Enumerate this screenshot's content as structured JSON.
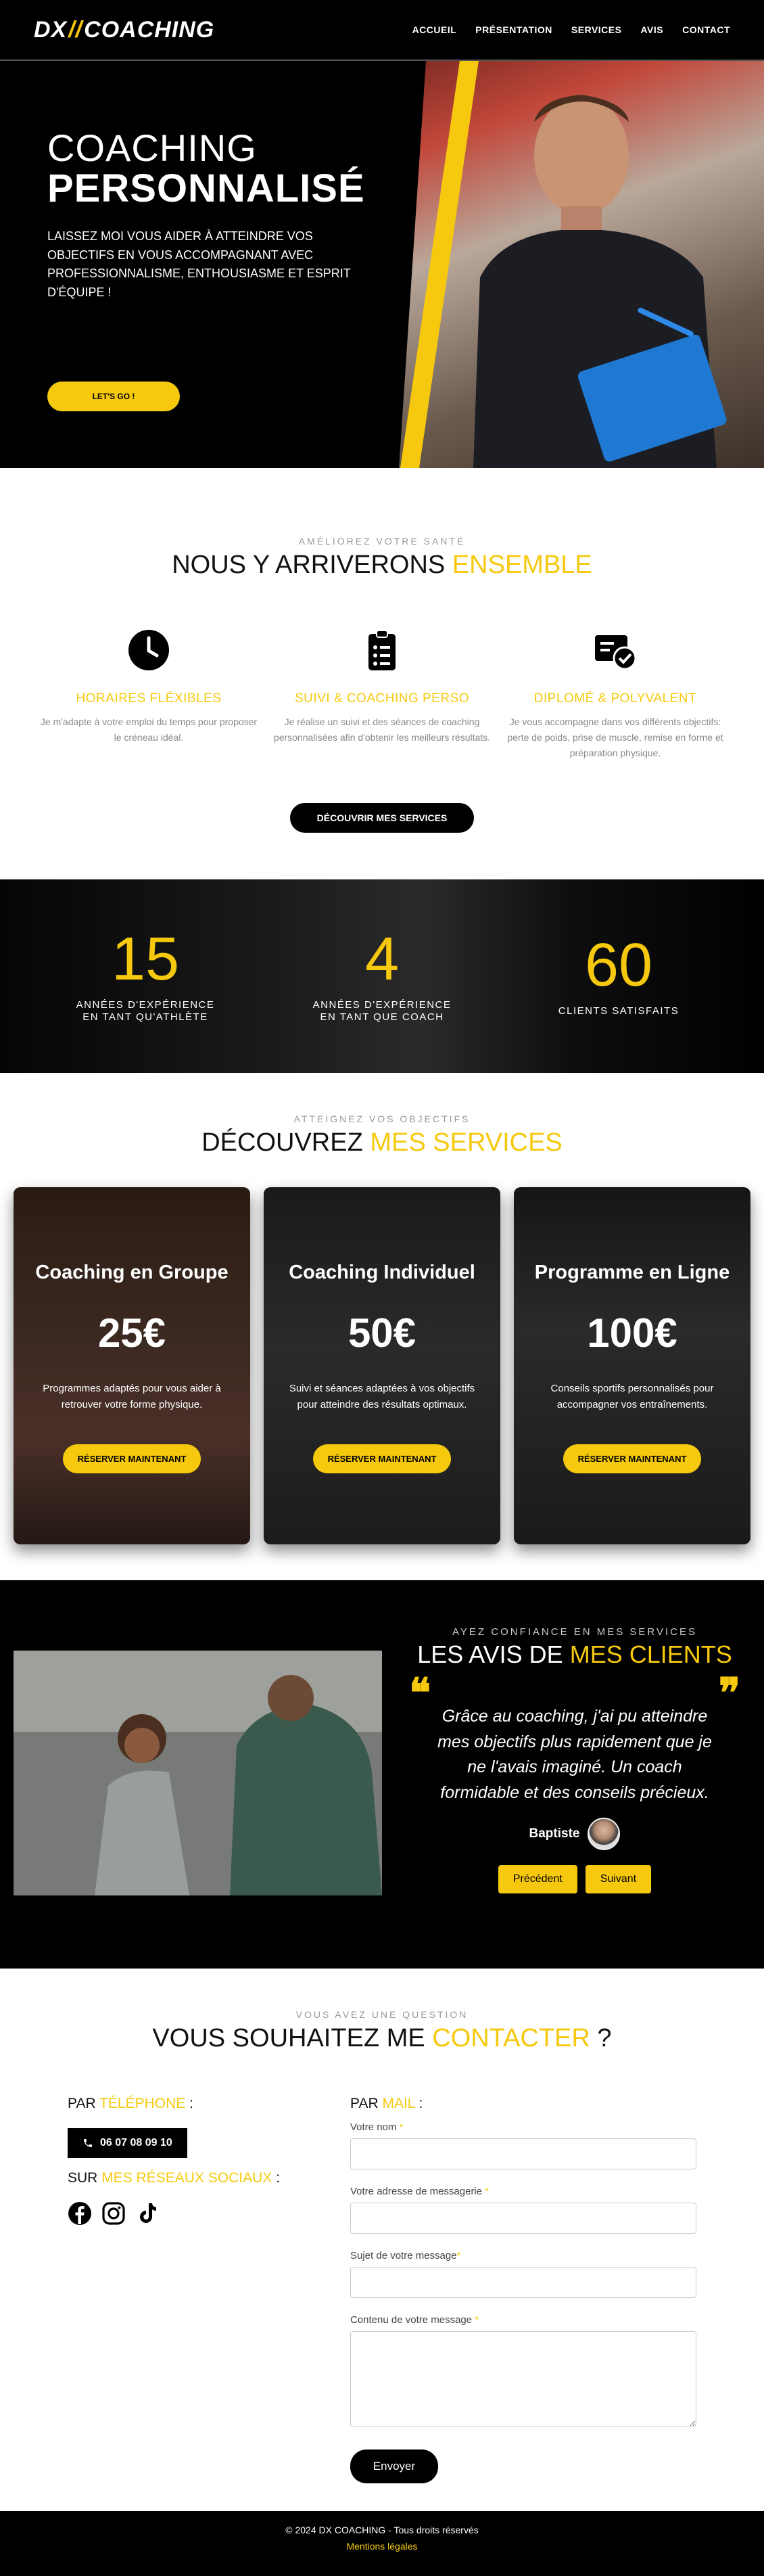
{
  "nav": {
    "logo_left": "DX",
    "logo_mark": "//",
    "logo_right": "COACHING",
    "items": [
      "ACCUEIL",
      "PRÉSENTATION",
      "SERVICES",
      "AVIS",
      "CONTACT"
    ]
  },
  "hero": {
    "title_light": "COACHING",
    "title_bold": "PERSONNALISÉ",
    "text": "LAISSEZ MOI VOUS AIDER À ATTEINDRE VOS OBJECTIFS EN VOUS ACCOMPAGNANT AVEC PROFESSIONNALISME, ENTHOUSIASME ET ESPRIT D'ÉQUIPE !",
    "cta": "LET'S GO !"
  },
  "features": {
    "kicker": "AMÉLIOREZ VOTRE SANTÉ",
    "title_main": "NOUS Y ARRIVERONS ",
    "title_accent": "ENSEMBLE",
    "items": [
      {
        "icon": "clock-icon",
        "title": "HORAIRES FLÉXIBLES",
        "text": "Je m'adapte à votre emploi du temps pour proposer le créneau idéal."
      },
      {
        "icon": "clipboard-list-icon",
        "title": "SUIVI & COACHING PERSO",
        "text": "Je réalise un suivi et des séances de coaching personnalisées afin d'obtenir les meilleurs résultats."
      },
      {
        "icon": "certificate-check-icon",
        "title": "DIPLOMÉ & POLYVALENT",
        "text": "Je vous accompagne dans vos différents objectifs: perte de poids, prise de muscle, remise en forme et préparation physique."
      }
    ],
    "cta": "DÉCOUVRIR MES SERVICES"
  },
  "stats": [
    {
      "num": "15",
      "label_1": "ANNÉES D'EXPÉRIENCE",
      "label_2": "EN TANT QU'ATHLÈTE"
    },
    {
      "num": "4",
      "label_1": "ANNÉES D'EXPÉRIENCE",
      "label_2": "EN TANT QUE COACH"
    },
    {
      "num": "60",
      "label_1": "CLIENTS SATISFAITS",
      "label_2": ""
    }
  ],
  "services": {
    "kicker": "ATTEIGNEZ VOS OBJECTIFS",
    "title_main": "DÉCOUVREZ ",
    "title_accent": "MES SERVICES",
    "cards": [
      {
        "title": "Coaching en Groupe",
        "price": "25€",
        "text": "Programmes adaptés pour vous aider à retrouver votre forme physique.",
        "cta": "RÉSERVER MAINTENANT"
      },
      {
        "title": "Coaching Individuel",
        "price": "50€",
        "text": "Suivi et séances adaptées à vos objectifs pour atteindre des résultats optimaux.",
        "cta": "RÉSERVER MAINTENANT"
      },
      {
        "title": "Programme en Ligne",
        "price": "100€",
        "text": "Conseils sportifs personnalisés pour accompagner vos entraînements.",
        "cta": "RÉSERVER MAINTENANT"
      }
    ]
  },
  "reviews": {
    "kicker": "AYEZ CONFIANCE EN MES SERVICES",
    "title_main": "LES AVIS DE ",
    "title_accent": "MES CLIENTS",
    "quote_open": "❝",
    "quote_close": "❞",
    "text": "Grâce au coaching, j'ai pu atteindre mes objectifs plus rapidement que je ne l'avais imaginé. Un coach formidable et des conseils précieux.",
    "author": "Baptiste",
    "prev": "Précédent",
    "next": "Suivant"
  },
  "contact": {
    "kicker": "VOUS AVEZ UNE QUESTION",
    "title_main": "VOUS SOUHAITEZ ME ",
    "title_accent": "CONTACTER",
    "title_end": " ?",
    "phone_h_main": "PAR ",
    "phone_h_accent": "TÉLÉPHONE",
    "phone_h_end": " :",
    "phone": "06 07 08 09 10",
    "social_h_main": "SUR ",
    "social_h_accent": "MES RÉSEAUX SOCIAUX",
    "social_h_end": " :",
    "mail_h_main": "PAR ",
    "mail_h_accent": "MAIL",
    "mail_h_end": " :",
    "fields": [
      {
        "label": "Votre nom ",
        "req": "*"
      },
      {
        "label": "Votre adresse de messagerie ",
        "req": "*"
      },
      {
        "label": "Sujet de votre message",
        "req": "*"
      },
      {
        "label": "Contenu de votre message ",
        "req": "*"
      }
    ],
    "submit": "Envoyer"
  },
  "footer": {
    "copyright": "© 2024 DX COACHING - Tous droits réservés",
    "legal": "Mentions légales"
  }
}
